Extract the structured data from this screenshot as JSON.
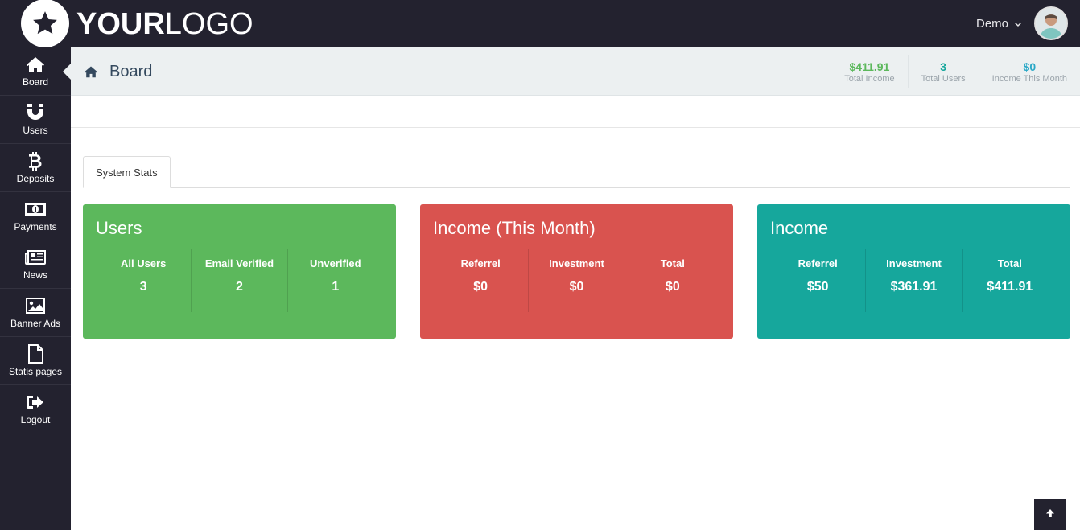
{
  "logo": {
    "text_bold": "YOUR",
    "text_light": "LOGO"
  },
  "user": {
    "name": "Demo"
  },
  "sidebar": {
    "items": [
      {
        "label": "Board",
        "icon": "home-icon",
        "active": true
      },
      {
        "label": "Users",
        "icon": "magnet-icon"
      },
      {
        "label": "Deposits",
        "icon": "bitcoin-icon"
      },
      {
        "label": "Payments",
        "icon": "money-icon"
      },
      {
        "label": "News",
        "icon": "newspaper-icon"
      },
      {
        "label": "Banner Ads",
        "icon": "image-icon"
      },
      {
        "label": "Statis pages",
        "icon": "file-icon"
      },
      {
        "label": "Logout",
        "icon": "sign-out-icon"
      }
    ]
  },
  "header": {
    "title": "Board",
    "stats": [
      {
        "value": "$411.91",
        "label": "Total Income",
        "color": "#5cb85c"
      },
      {
        "value": "3",
        "label": "Total Users",
        "color": "#16a79c"
      },
      {
        "value": "$0",
        "label": "Income This Month",
        "color": "#2aa8c7"
      }
    ]
  },
  "tabs": [
    {
      "label": "System Stats"
    }
  ],
  "cards": [
    {
      "title": "Users",
      "color": "#5cb85c",
      "columns": [
        {
          "label": "All Users",
          "value": "3"
        },
        {
          "label": "Email Verified",
          "value": "2"
        },
        {
          "label": "Unverified",
          "value": "1"
        }
      ]
    },
    {
      "title": "Income (This Month)",
      "color": "#d9534f",
      "columns": [
        {
          "label": "Referrel",
          "value": "$0"
        },
        {
          "label": "Investment",
          "value": "$0"
        },
        {
          "label": "Total",
          "value": "$0"
        }
      ]
    },
    {
      "title": "Income",
      "color": "#16a79c",
      "columns": [
        {
          "label": "Referrel",
          "value": "$50"
        },
        {
          "label": "Investment",
          "value": "$361.91"
        },
        {
          "label": "Total",
          "value": "$411.91"
        }
      ]
    }
  ],
  "scroll_top": {
    "icon": "arrow-up-icon"
  }
}
